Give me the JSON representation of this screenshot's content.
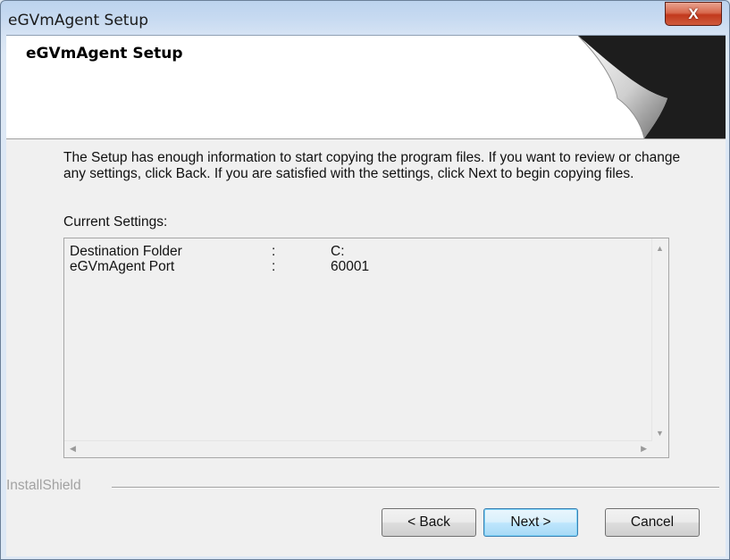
{
  "window": {
    "title": "eGVmAgent Setup",
    "close_glyph": "X"
  },
  "header": {
    "title": "eGVmAgent Setup"
  },
  "body": {
    "intro": "The Setup has enough information to start copying the program files. If you want to review or change any settings, click Back. If you are satisfied with the settings, click Next to begin copying files.",
    "settings_label": "Current Settings:",
    "settings": [
      {
        "key": "Destination Folder",
        "sep": ":",
        "value": "C:"
      },
      {
        "key": "eGVmAgent Port",
        "sep": ":",
        "value": "60001"
      }
    ]
  },
  "footer": {
    "brand": "InstallShield",
    "back_label": "< Back",
    "next_label": "Next >",
    "cancel_label": "Cancel"
  },
  "colors": {
    "accent_default_button": "#3c7fb1",
    "close_button": "#c2391d"
  }
}
